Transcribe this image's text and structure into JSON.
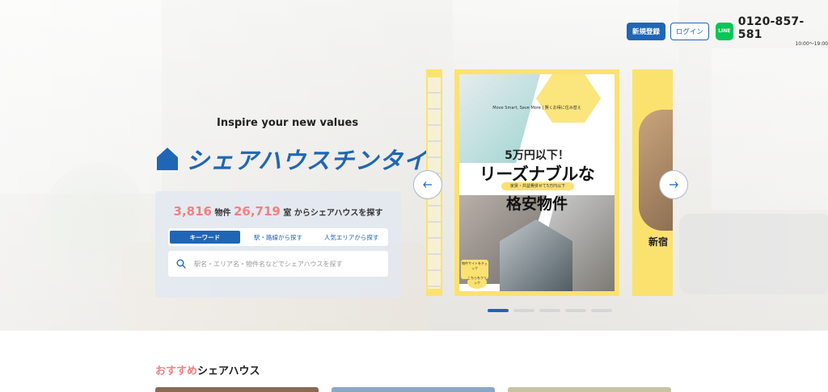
{
  "header": {
    "register_label": "新規登録",
    "login_label": "ログイン",
    "line_icon_text": "LINE",
    "phone_number": "0120-857-581",
    "phone_hours": "10:00～19:00"
  },
  "hero": {
    "tagline": "Inspire your new values",
    "logo_text": "シェアハウスチンタイ",
    "stats": {
      "properties": "3,816",
      "properties_unit": "物件",
      "rooms": "26,719",
      "rooms_suffix": "室 からシェアハウスを探す"
    },
    "tabs": [
      "キーワード",
      "駅・路線から探す",
      "人気エリアから探す"
    ],
    "active_tab": 0,
    "search_placeholder": "駅名・エリア名・物件名などでシェアハウスを探す"
  },
  "carousel": {
    "main_slide": {
      "subtitle": "Move Smart, Save More | 賢くお得に住み替え",
      "headline_1": "5万円以下！",
      "headline_2": "リーズナブルな",
      "pill": "家賃・共益費併せて5万円以下",
      "headline_3": "格安物件",
      "badge_text": "物件サイトをチェック",
      "badge2_text": "こちらをクリック"
    },
    "right_slide_text": "新宿",
    "dots": 5,
    "active_dot": 0
  },
  "section": {
    "title_highlight": "おすすめ",
    "title_rest": "シェアハウス"
  },
  "colors": {
    "brand_blue": "#1f66b6",
    "accent_pink": "#f47f7f",
    "slide_yellow": "#fbe26f",
    "line_green": "#06c755"
  }
}
